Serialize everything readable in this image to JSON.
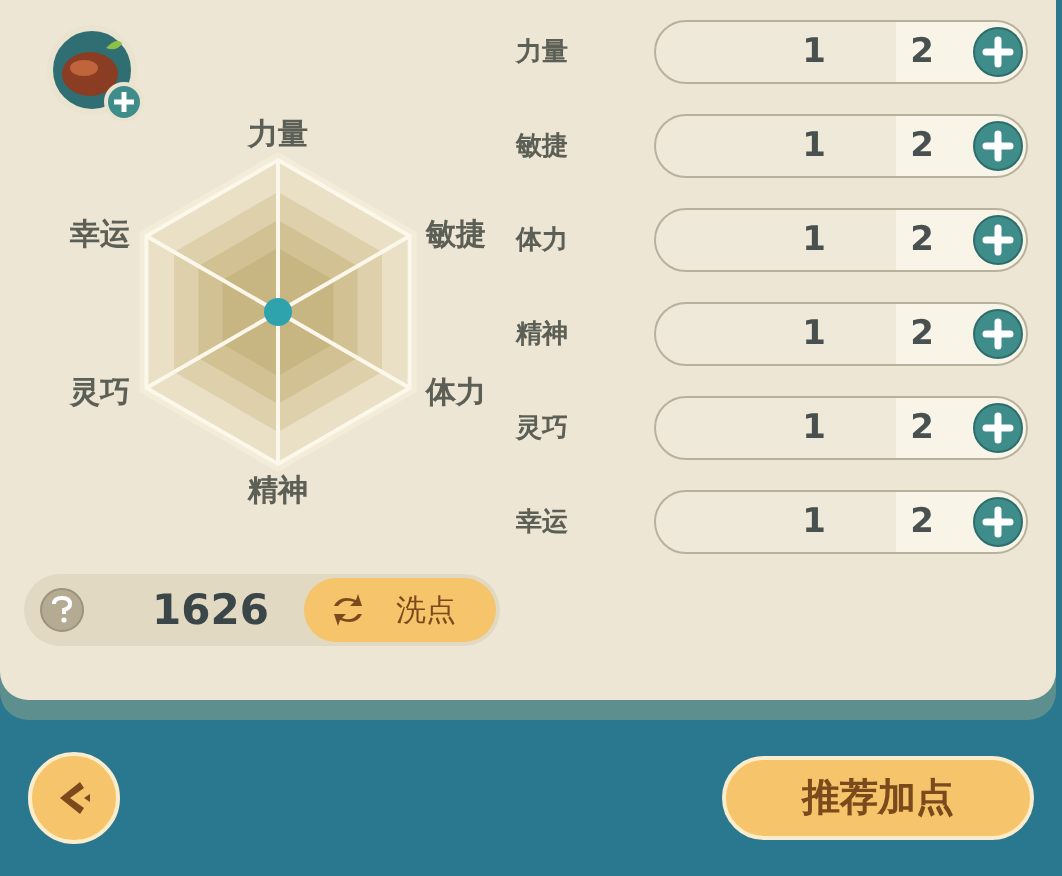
{
  "radar": {
    "labels": [
      "力量",
      "敏捷",
      "体力",
      "精神",
      "灵巧",
      "幸运"
    ]
  },
  "stats": [
    {
      "name": "力量",
      "current": "1",
      "next": "2"
    },
    {
      "name": "敏捷",
      "current": "1",
      "next": "2"
    },
    {
      "name": "体力",
      "current": "1",
      "next": "2"
    },
    {
      "name": "精神",
      "current": "1",
      "next": "2"
    },
    {
      "name": "灵巧",
      "current": "1",
      "next": "2"
    },
    {
      "name": "幸运",
      "current": "1",
      "next": "2"
    }
  ],
  "points": {
    "value": "1626",
    "reset_button": "洗点"
  },
  "recommend_button": "推荐加点"
}
